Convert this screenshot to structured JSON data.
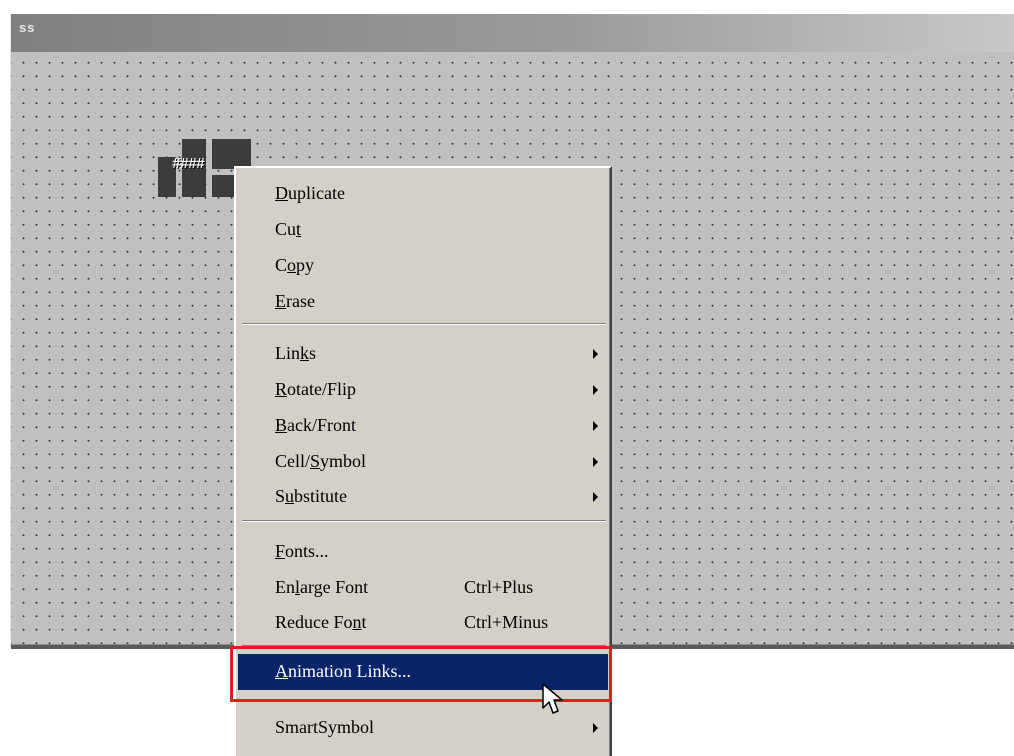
{
  "window": {
    "title": "ss"
  },
  "canvas": {
    "object_text": "####"
  },
  "menu": {
    "items": [
      {
        "pre": "",
        "ul": "D",
        "post": "uplicate",
        "shortcut": "",
        "submenu": false
      },
      {
        "pre": "Cu",
        "ul": "t",
        "post": "",
        "shortcut": "",
        "submenu": false
      },
      {
        "pre": "C",
        "ul": "o",
        "post": "py",
        "shortcut": "",
        "submenu": false
      },
      {
        "pre": "",
        "ul": "E",
        "post": "rase",
        "shortcut": "",
        "submenu": false
      },
      {
        "pre": "Lin",
        "ul": "k",
        "post": "s",
        "shortcut": "",
        "submenu": true
      },
      {
        "pre": "",
        "ul": "R",
        "post": "otate/Flip",
        "shortcut": "",
        "submenu": true
      },
      {
        "pre": "",
        "ul": "B",
        "post": "ack/Front",
        "shortcut": "",
        "submenu": true
      },
      {
        "pre": "Cell/",
        "ul": "S",
        "post": "ymbol",
        "shortcut": "",
        "submenu": true
      },
      {
        "pre": "S",
        "ul": "u",
        "post": "bstitute",
        "shortcut": "",
        "submenu": true
      },
      {
        "pre": "",
        "ul": "F",
        "post": "onts...",
        "shortcut": "",
        "submenu": false
      },
      {
        "pre": "En",
        "ul": "l",
        "post": "arge Font",
        "shortcut": "Ctrl+Plus",
        "submenu": false
      },
      {
        "pre": "Reduce Fo",
        "ul": "n",
        "post": "t",
        "shortcut": "Ctrl+Minus",
        "submenu": false
      },
      {
        "pre": "",
        "ul": "A",
        "post": "nimation Links...",
        "shortcut": "",
        "submenu": false,
        "highlighted": true
      },
      {
        "pre": "SmartSymbol",
        "ul": "",
        "post": "",
        "shortcut": "",
        "submenu": true
      }
    ]
  },
  "colors": {
    "menu_bg": "#d4d0c8",
    "highlight_bg": "#0a246a",
    "highlight_box": "#e02020",
    "canvas_bg": "#c0c0c0"
  }
}
